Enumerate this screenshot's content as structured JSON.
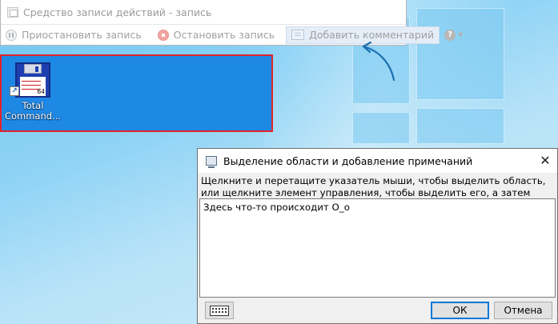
{
  "recorder": {
    "title": "Средство записи действий - запись",
    "pause_label": "Приостановить запись",
    "stop_label": "Остановить запись",
    "comment_label": "Добавить комментарий",
    "help_glyph": "?"
  },
  "desktop": {
    "icon_label_line1": "Total",
    "icon_label_line2": "Command...",
    "icon_badge": "64"
  },
  "dialog": {
    "title": "Выделение области и добавление примечаний",
    "instructions": "Щелкните и перетащите указатель мыши, чтобы выделить область, или щелкните элемент управления, чтобы выделить его, а затем введите примечание:",
    "text_value": "Здесь что-то происходит О_о",
    "ok_label": "ОК",
    "cancel_label": "Отмена",
    "close_glyph": "✕"
  },
  "colors": {
    "selection_border": "#e0242a",
    "selection_fill": "#1e88e5",
    "arrow": "#1a6fb0",
    "ok_border": "#0078d7"
  }
}
